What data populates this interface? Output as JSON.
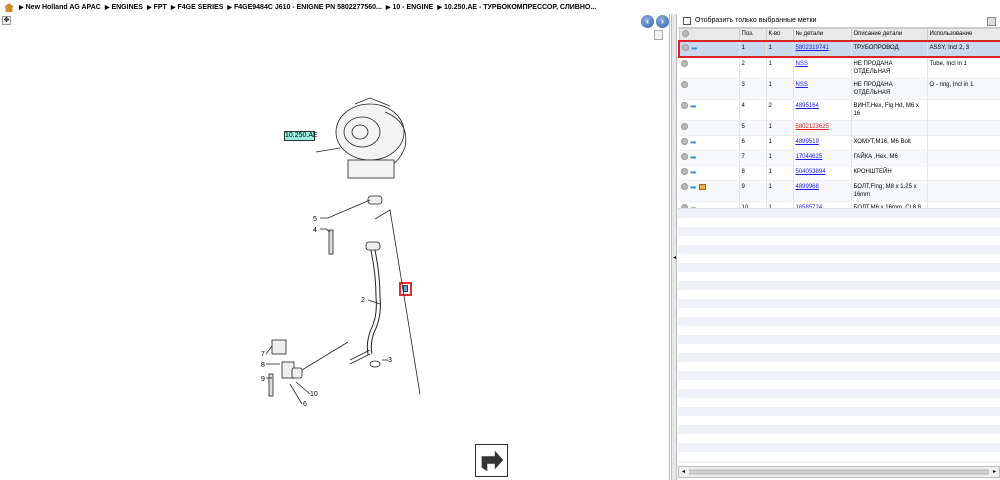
{
  "breadcrumb": [
    "New Holland AG APAC",
    "ENGINES",
    "FPT",
    "F4GE SERIES",
    "F4GE9484C J610 - ENIGNE PN 5802277560...",
    "10 - ENGINE",
    "10.250.AE - ТУРБОКОМПРЕССОР, СЛИВНО..."
  ],
  "diagram": {
    "callout": "10.250.AE",
    "labels": [
      "5",
      "4",
      "2",
      "7",
      "8",
      "9",
      "10",
      "6",
      "3"
    ]
  },
  "filter": {
    "label": "Отобразить только выбранные метки"
  },
  "table": {
    "headers": [
      "Поз.",
      "К-во",
      "№ детали",
      "Описание детали",
      "Использование"
    ],
    "rows": [
      {
        "pos": "1",
        "qty": "1",
        "part": "5802319741",
        "desc": "ТРУБОПРОВОД",
        "usage": "ASSY, Incl 2, 3",
        "icon": "arrow",
        "selected": true
      },
      {
        "pos": "2",
        "qty": "1",
        "part": "NSS",
        "desc": "НЕ ПРОДАНА ОТДЕЛЬНАЯ",
        "usage": "Tube, Incl in 1",
        "icon": "none"
      },
      {
        "pos": "3",
        "qty": "1",
        "part": "NSS",
        "desc": "НЕ ПРОДАНА ОТДЕЛЬНАЯ",
        "usage": "O - ring, Incl in 1",
        "icon": "none"
      },
      {
        "pos": "4",
        "qty": "2",
        "part": "4895164",
        "desc": "ВИНТ,Hex, Flg Hd, M6 x 16",
        "usage": "",
        "icon": "arrow"
      },
      {
        "pos": "5",
        "qty": "1",
        "part": "5802123625",
        "desc": "",
        "usage": "",
        "icon": "none",
        "red": true
      },
      {
        "pos": "6",
        "qty": "1",
        "part": "4899519",
        "desc": "ХОМУТ,M16, M6 Bolt",
        "usage": "",
        "icon": "arrow"
      },
      {
        "pos": "7",
        "qty": "1",
        "part": "17044625",
        "desc": "ГАЙКА ,Hex, M6",
        "usage": "",
        "icon": "arrow"
      },
      {
        "pos": "8",
        "qty": "1",
        "part": "504053894",
        "desc": "КРОНШТЕЙН",
        "usage": "",
        "icon": "arrow"
      },
      {
        "pos": "9",
        "qty": "1",
        "part": "4899968",
        "desc": "БОЛТ,Flng, M8 x 1.25 x 16mm",
        "usage": "",
        "icon": "arrow-box"
      },
      {
        "pos": "10",
        "qty": "1",
        "part": "16585724",
        "desc": "БОЛТ,M6 x 16mm, Cl 8.8",
        "usage": "",
        "icon": "green"
      }
    ]
  }
}
